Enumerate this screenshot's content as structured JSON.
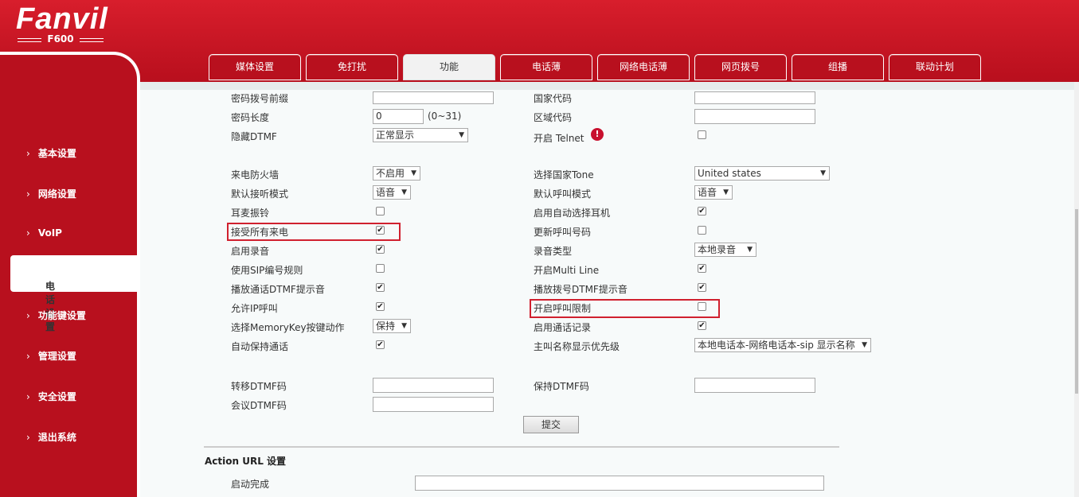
{
  "brand": {
    "name": "Fanvil",
    "model": "F600"
  },
  "sidebar": {
    "items": [
      {
        "label": "基本设置"
      },
      {
        "label": "网络设置"
      },
      {
        "label": "VoIP"
      },
      {
        "label": "电话设置"
      },
      {
        "label": "功能键设置"
      },
      {
        "label": "管理设置"
      },
      {
        "label": "安全设置"
      },
      {
        "label": "退出系统"
      }
    ],
    "chevron": "›"
  },
  "tabs": [
    {
      "label": "媒体设置"
    },
    {
      "label": "免打扰"
    },
    {
      "label": "功能"
    },
    {
      "label": "电话薄"
    },
    {
      "label": "网络电话薄"
    },
    {
      "label": "网页拨号"
    },
    {
      "label": "组播"
    },
    {
      "label": "联动计划"
    }
  ],
  "form": {
    "password_dial_prefix": {
      "label": "密码拨号前缀",
      "value": ""
    },
    "country_code": {
      "label": "国家代码",
      "value": ""
    },
    "password_length": {
      "label": "密码长度",
      "value": "0",
      "hint": "(0~31)"
    },
    "area_code": {
      "label": "区域代码",
      "value": ""
    },
    "hide_dtmf": {
      "label": "隐藏DTMF",
      "value": "正常显示"
    },
    "enable_telnet": {
      "label": "开启 Telnet",
      "checked": false,
      "warn_icon": "!"
    },
    "call_firewall": {
      "label": "来电防火墙",
      "value": "不启用"
    },
    "country_tone": {
      "label": "选择国家Tone",
      "value": "United states"
    },
    "default_answer_mode": {
      "label": "默认接听模式",
      "value": "语音"
    },
    "default_call_mode": {
      "label": "默认呼叫模式",
      "value": "语音"
    },
    "headset_ring": {
      "label": "耳麦振铃",
      "checked": false
    },
    "auto_headset": {
      "label": "启用自动选择耳机",
      "checked": true
    },
    "accept_all_calls": {
      "label": "接受所有来电",
      "checked": true
    },
    "update_call_number": {
      "label": "更新呼叫号码",
      "checked": false
    },
    "enable_recording": {
      "label": "启用录音",
      "checked": true
    },
    "recording_type": {
      "label": "录音类型",
      "value": "本地录音"
    },
    "use_sip_dial_rule": {
      "label": "使用SIP编号规则",
      "checked": false
    },
    "multi_line": {
      "label": "开启Multi Line",
      "checked": true
    },
    "play_call_dtmf": {
      "label": "播放通话DTMF提示音",
      "checked": true
    },
    "play_dial_dtmf": {
      "label": "播放拨号DTMF提示音",
      "checked": true
    },
    "allow_ip_call": {
      "label": "允许IP呼叫",
      "checked": true
    },
    "call_restriction": {
      "label": "开启呼叫限制",
      "checked": false
    },
    "memorykey_action": {
      "label": "选择MemoryKey按键动作",
      "value": "保持"
    },
    "call_log": {
      "label": "启用通话记录",
      "checked": true
    },
    "auto_hold": {
      "label": "自动保持通话",
      "checked": true
    },
    "caller_name_priority": {
      "label": "主叫名称显示优先级",
      "value": "本地电话本-网络电话本-sip 显示名称"
    },
    "transfer_dtmf": {
      "label": "转移DTMF码",
      "value": ""
    },
    "hold_dtmf": {
      "label": "保持DTMF码",
      "value": ""
    },
    "conference_dtmf": {
      "label": "会议DTMF码",
      "value": ""
    },
    "submit_label": "提交"
  },
  "action_url": {
    "title": "Action URL 设置",
    "boot_complete": {
      "label": "启动完成",
      "value": ""
    }
  },
  "checkmark": "✔",
  "select_arrow": "▼"
}
